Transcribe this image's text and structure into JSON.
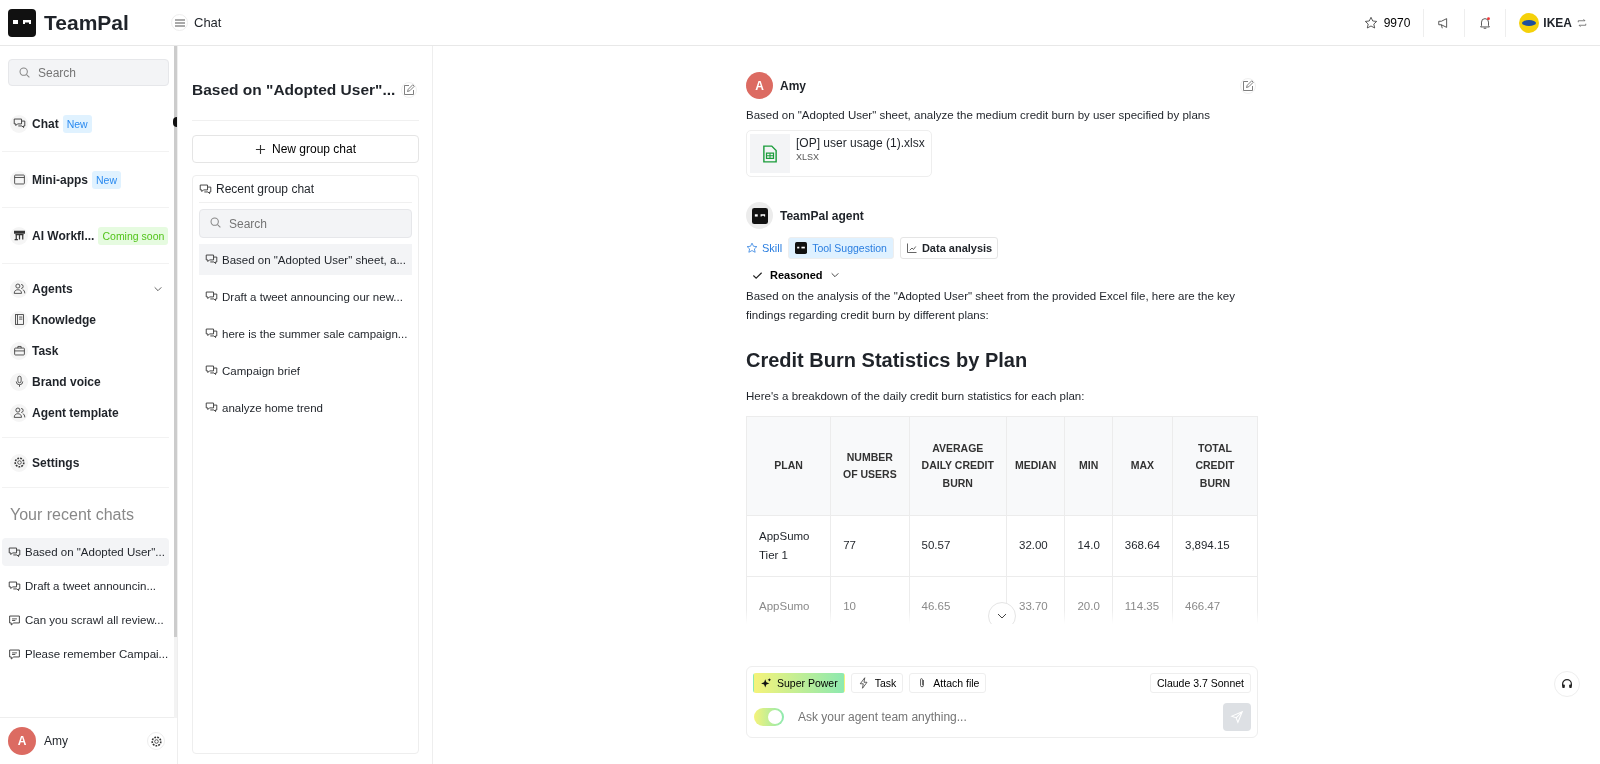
{
  "brand": {
    "name": "TeamPal"
  },
  "header": {
    "title": "Chat",
    "credits": "9970",
    "workspace": "IKEA"
  },
  "sidebar": {
    "search": {
      "placeholder": "Search"
    },
    "groups": [
      [
        {
          "label": "Chat",
          "kind": "chat",
          "badge": {
            "text": "New",
            "kind": "info"
          }
        }
      ],
      [
        {
          "label": "Mini-apps",
          "kind": "window",
          "badge": {
            "text": "New",
            "kind": "info"
          }
        }
      ],
      [
        {
          "label": "AI Workfl...",
          "kind": "flow",
          "badge": {
            "text": "Coming soon",
            "kind": "success"
          }
        }
      ],
      [
        {
          "label": "Agents",
          "kind": "users",
          "expanded": false
        },
        {
          "label": "Knowledge",
          "kind": "book"
        },
        {
          "label": "Task",
          "kind": "case"
        },
        {
          "label": "Brand voice",
          "kind": "mic"
        },
        {
          "label": "Agent template",
          "kind": "users"
        }
      ],
      [
        {
          "label": "Settings",
          "kind": "gear"
        }
      ]
    ],
    "recent_title": "Your recent chats",
    "recent": [
      {
        "label": "Based on \"Adopted User\"...",
        "kind": "group",
        "selected": true
      },
      {
        "label": "Draft a tweet announcin...",
        "kind": "group",
        "selected": false
      },
      {
        "label": "Can you scrawl all review...",
        "kind": "single",
        "selected": false
      },
      {
        "label": "Please remember Campai...",
        "kind": "single",
        "selected": false
      }
    ],
    "user": {
      "initial": "A",
      "name": "Amy"
    }
  },
  "chat_panel": {
    "title": "Based on \"Adopted User\"...",
    "new_button": "New group chat",
    "list_title": "Recent group chat",
    "search": {
      "placeholder": "Search"
    },
    "items": [
      {
        "label": "Based on \"Adopted User\" sheet, a...",
        "selected": true
      },
      {
        "label": "Draft a tweet announcing our new...",
        "selected": false
      },
      {
        "label": "here is the summer sale campaign...",
        "selected": false
      },
      {
        "label": "Campaign brief",
        "selected": false
      },
      {
        "label": "analyze home trend",
        "selected": false
      }
    ]
  },
  "conversation": {
    "user_message": {
      "initial": "A",
      "author": "Amy",
      "text": "Based on \"Adopted User\" sheet, analyze the medium credit burn by user specified by plans",
      "attachment": {
        "name": "[OP] user usage (1).xlsx",
        "type": "XLSX"
      }
    },
    "agent_message": {
      "author": "TeamPal agent",
      "tags": [
        {
          "label": "Skill",
          "kind": "link"
        },
        {
          "label": "Tool Suggestion",
          "kind": "tool"
        },
        {
          "label": "Data analysis",
          "kind": "chip"
        }
      ],
      "reasoned": "Reasoned",
      "intro": "Based on the analysis of the \"Adopted User\" sheet from the provided Excel file, here are the key findings regarding credit burn by different plans:",
      "heading": "Credit Burn Statistics by Plan",
      "lead": "Here's a breakdown of the daily credit burn statistics for each plan:",
      "table": {
        "columns": [
          "PLAN",
          "NUMBER OF USERS",
          "AVERAGE DAILY CREDIT BURN",
          "MEDIAN",
          "MIN",
          "MAX",
          "TOTAL CREDIT BURN"
        ],
        "rows": [
          [
            "AppSumo Tier 1",
            "77",
            "50.57",
            "32.00",
            "14.0",
            "368.64",
            "3,894.15"
          ],
          [
            "AppSumo",
            "10",
            "46.65",
            "33.70",
            "20.0",
            "114.35",
            "466.47"
          ]
        ]
      }
    }
  },
  "composer": {
    "tools": [
      {
        "label": "Super Power",
        "kind": "power"
      },
      {
        "label": "Task",
        "kind": "bolt"
      },
      {
        "label": "Attach file",
        "kind": "clip"
      }
    ],
    "model": "Claude 3.7 Sonnet",
    "placeholder": "Ask your agent team anything...",
    "toggle_on": true
  }
}
